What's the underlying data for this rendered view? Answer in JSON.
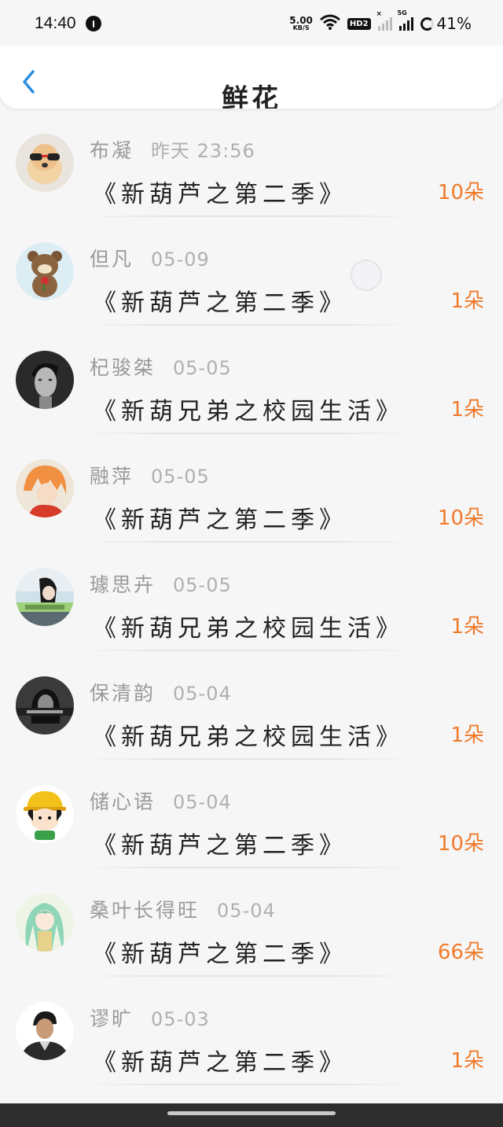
{
  "status_bar": {
    "time": "14:40",
    "net_speed_value": "5.00",
    "net_speed_unit": "KB/S",
    "hd_badge": "HD2",
    "signal_label": "5G",
    "battery_percent": "41%"
  },
  "header": {
    "title": "鲜花",
    "back_icon": "chevron-left-icon",
    "accent_color": "#2b8ee0"
  },
  "records": [
    {
      "name": "布凝",
      "time": "昨天 23:56",
      "book": "《新葫芦之第二季》",
      "count": "10朵",
      "avatar": "dog-with-sunglasses"
    },
    {
      "name": "但凡",
      "time": "05-09",
      "book": "《新葫芦之第二季》",
      "count": "1朵",
      "avatar": "bear-with-rose"
    },
    {
      "name": "杞骏桀",
      "time": "05-05",
      "book": "《新葫兄弟之校园生活》",
      "count": "1朵",
      "avatar": "man-portrait-bw"
    },
    {
      "name": "融萍",
      "time": "05-05",
      "book": "《新葫芦之第二季》",
      "count": "10朵",
      "avatar": "orange-hair-anime"
    },
    {
      "name": "璩思卉",
      "time": "05-05",
      "book": "《新葫兄弟之校园生活》",
      "count": "1朵",
      "avatar": "girl-photo-caption"
    },
    {
      "name": "保清韵",
      "time": "05-04",
      "book": "《新葫兄弟之校园生活》",
      "count": "1朵",
      "avatar": "dark-photo-caption"
    },
    {
      "name": "储心语",
      "time": "05-04",
      "book": "《新葫芦之第二季》",
      "count": "10朵",
      "avatar": "cartoon-girl-hat"
    },
    {
      "name": "桑叶长得旺",
      "time": "05-04",
      "book": "《新葫芦之第二季》",
      "count": "66朵",
      "avatar": "green-hair-anime"
    },
    {
      "name": "谬旷",
      "time": "05-03",
      "book": "《新葫芦之第二季》",
      "count": "1朵",
      "avatar": "man-photo"
    }
  ],
  "colors": {
    "count_color": "#f07a2a",
    "name_color": "#9a9a9a",
    "book_color": "#222222"
  }
}
